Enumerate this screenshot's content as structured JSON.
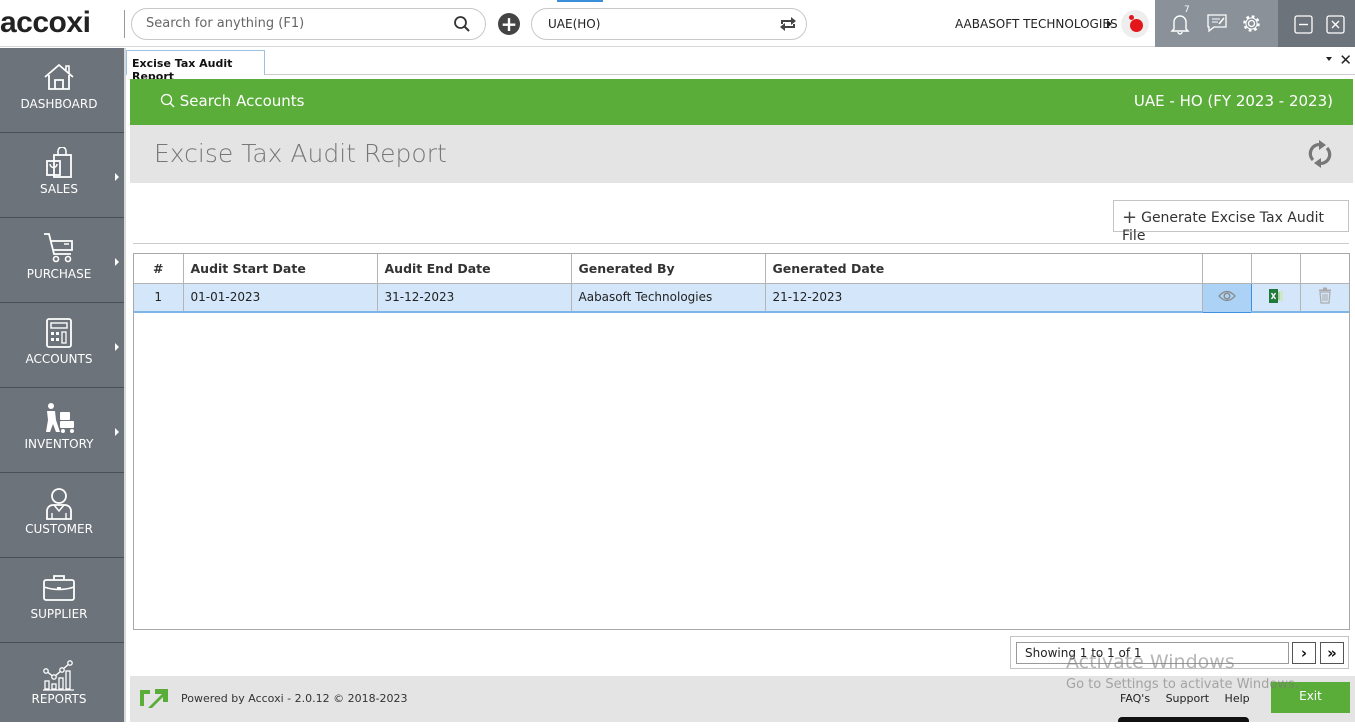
{
  "app": {
    "logo_text": "accoxi",
    "search_placeholder": "Search for anything (F1)",
    "branch_value": "UAE(HO)",
    "company_name": "AABASOFT TECHNOLOGIES",
    "notification_count": "7"
  },
  "sidebar": {
    "items": [
      {
        "label": "DASHBOARD",
        "icon": "house-icon",
        "has_submenu": false
      },
      {
        "label": "SALES",
        "icon": "shopping-bag-icon",
        "has_submenu": true
      },
      {
        "label": "PURCHASE",
        "icon": "cart-icon",
        "has_submenu": true
      },
      {
        "label": "ACCOUNTS",
        "icon": "calculator-icon",
        "has_submenu": true
      },
      {
        "label": "INVENTORY",
        "icon": "worker-trolley-icon",
        "has_submenu": true
      },
      {
        "label": "CUSTOMER",
        "icon": "person-icon",
        "has_submenu": false
      },
      {
        "label": "SUPPLIER",
        "icon": "briefcase-icon",
        "has_submenu": false
      },
      {
        "label": "REPORTS",
        "icon": "chart-icon",
        "has_submenu": false
      }
    ]
  },
  "tabs": [
    {
      "label": "Excise Tax Audit Report",
      "active": true
    }
  ],
  "header": {
    "search_accounts": "Search Accounts",
    "fiscal_label": "UAE - HO (FY 2023 - 2023)",
    "page_title": "Excise Tax Audit Report"
  },
  "toolbar": {
    "generate_label": "Generate Excise Tax Audit File",
    "generate_accesskey": "G"
  },
  "table": {
    "columns": [
      "#",
      "Audit Start Date",
      "Audit End Date",
      "Generated By",
      "Generated Date",
      "",
      "",
      ""
    ],
    "rows": [
      {
        "index": "1",
        "start": "01-01-2023",
        "end": "31-12-2023",
        "by": "Aabasoft Technologies",
        "date": "21-12-2023",
        "actions": [
          "view-icon",
          "excel-icon",
          "delete-icon"
        ]
      }
    ]
  },
  "pager": {
    "info": "Showing 1 to 1 of 1",
    "next": "›",
    "last": "»"
  },
  "footer": {
    "powered": "Powered by Accoxi - 2.0.12 © 2018-2023",
    "links": [
      "FAQ's",
      "Support",
      "Help"
    ],
    "exit_label": "Exit"
  },
  "overlay": {
    "watermark_title": "Activate Windows",
    "watermark_sub": "Go to Settings to activate Windows."
  },
  "colors": {
    "brand_green": "#5bad3a",
    "sidebar_bg": "#6c737a",
    "row_selected": "#d4e7fa"
  }
}
